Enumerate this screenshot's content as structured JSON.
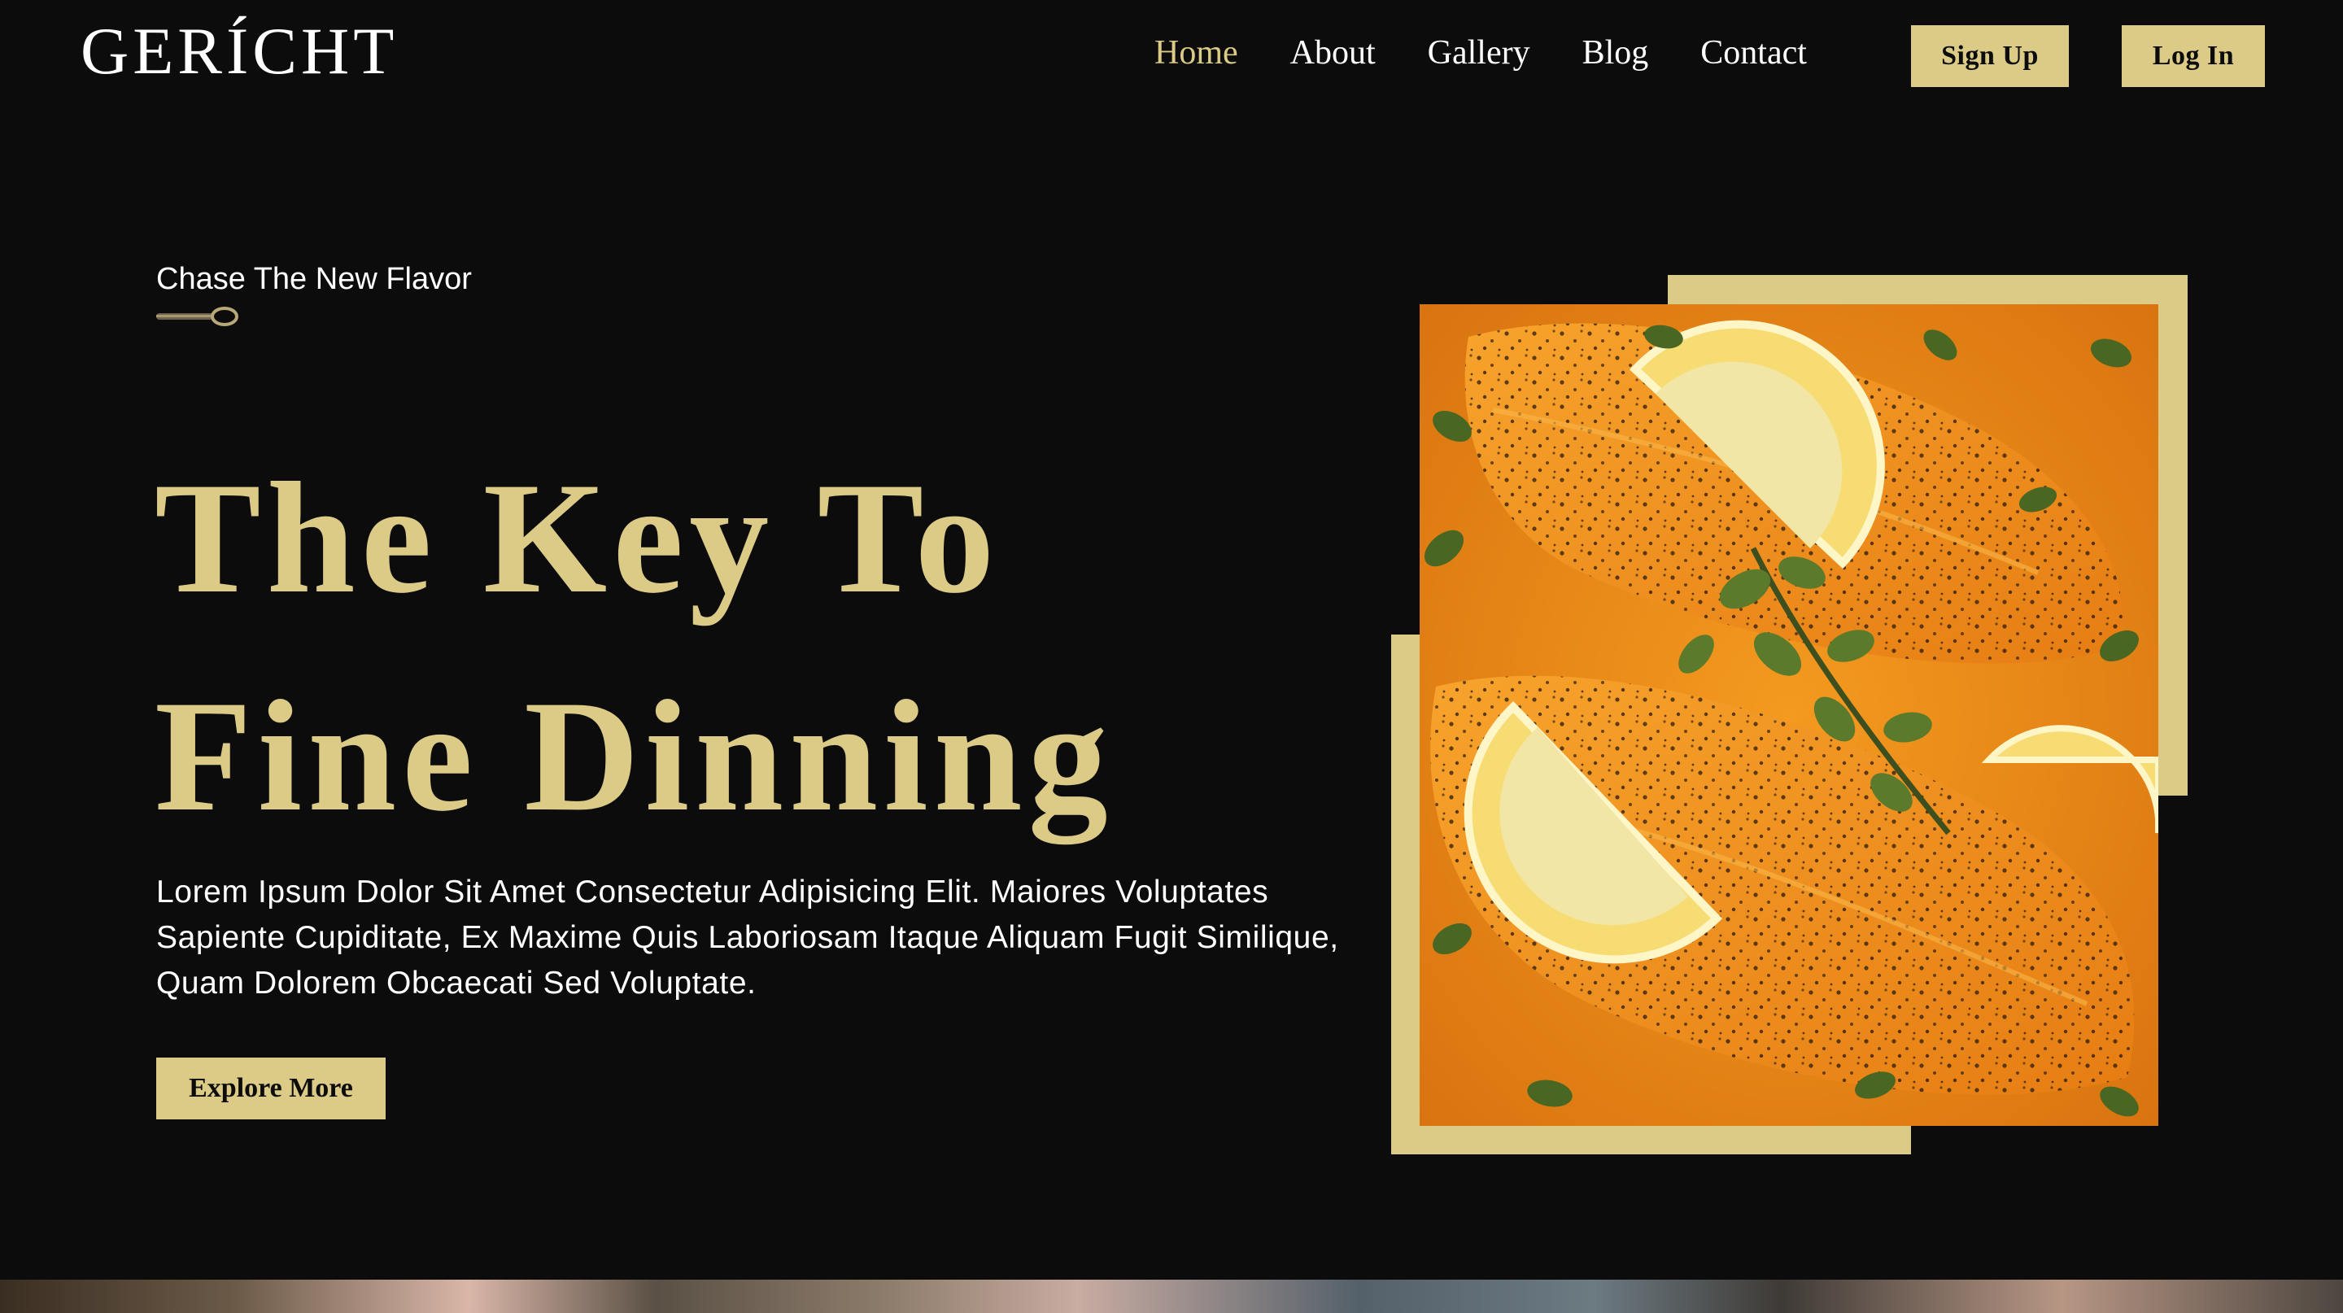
{
  "brand": {
    "logo": "GERÍCHT"
  },
  "nav": {
    "items": [
      {
        "label": "Home",
        "active": true
      },
      {
        "label": "About"
      },
      {
        "label": "Gallery"
      },
      {
        "label": "Blog"
      },
      {
        "label": "Contact"
      }
    ],
    "signup_label": "Sign Up",
    "login_label": "Log In"
  },
  "hero": {
    "tagline": "Chase The New Flavor",
    "headline_line1": "The Key To",
    "headline_line2": "Fine Dinning",
    "description": "Lorem Ipsum Dolor Sit Amet Consectetur Adipisicing Elit. Maiores Voluptates Sapiente Cupiditate, Ex Maxime Quis Laboriosam Itaque Aliquam Fugit Similique, Quam Dolorem Obcaecati Sed Voluptate.",
    "cta_label": "Explore More",
    "image_icon": "salmon-dish-photo"
  },
  "colors": {
    "accent": "#dcca87",
    "background": "#0c0c0c",
    "text": "#ffffff"
  }
}
